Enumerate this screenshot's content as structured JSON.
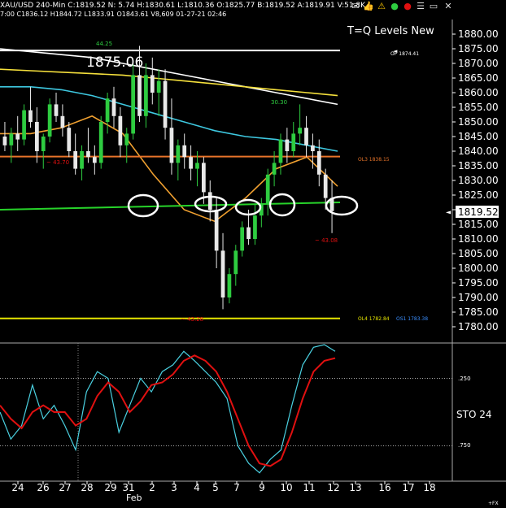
{
  "header": {
    "line1": "XAU/USD  240-Min  C:1819.52  N:  5.74  H:1830.61  L:1810.36  O:1825.77  B:1819.52  A:1819.91  V:51.8K",
    "line2": "7:00  C1836.12  H1844.72  L1833.91  O1843.61  V8,609  01-27-21  02:46"
  },
  "toolbar_icons": [
    "mail-icon",
    "thumbs-up-icon",
    "warning-icon",
    "green-circle-icon",
    "red-circle-icon",
    "list-icon",
    "window-icon",
    "close-icon"
  ],
  "colors": {
    "background": "#000000",
    "up_candle": "#2ecc40",
    "down_candle": "#e8e8e8",
    "ma_white": "#ffffff",
    "ma_yellow": "#f5e03c",
    "ma_cyan": "#3ec8e0",
    "ma_orange": "#f0a030",
    "level_orange": "#e8742a",
    "level_green": "#27d32a",
    "level_yellow": "#e6e600",
    "stoch_red": "#e01010",
    "stoch_cyan": "#4ad0e0"
  },
  "chart_title": "T=Q Levels New",
  "level_labels": {
    "op": "OP  1874.41",
    "ol3": "OL3  1838.15",
    "ol4": "OL4  1782.84",
    "os1": "OS1  1783.38"
  },
  "price_annotations": {
    "high_big": "1875.06",
    "small_44_25": "44.25",
    "mid_43_70": "~ 43.70",
    "right_43_08": "~ 43.08",
    "peak_30_30": "30.30",
    "low_43_28": "~ 43.28"
  },
  "current_price": "1819.52",
  "stoch_label": "STO  24",
  "stoch_levels": {
    "upper": ".250",
    "lower": ".750"
  },
  "fx_label": "+FX",
  "chart_data": [
    {
      "type": "candlestick",
      "title": "T=Q Levels New",
      "symbol": "XAU/USD",
      "timeframe": "240-Min",
      "ylim": [
        1775,
        1885
      ],
      "yticks": [
        1880,
        1875,
        1870,
        1865,
        1860,
        1855,
        1850,
        1845,
        1840,
        1835,
        1830,
        1825,
        1820,
        1815,
        1810,
        1805,
        1800,
        1795,
        1790,
        1785,
        1780
      ],
      "x_ticks": [
        "24",
        "26",
        "27",
        "28",
        "29",
        "31",
        "2",
        "3",
        "4",
        "5",
        "7",
        "9",
        "10",
        "11",
        "12",
        "13",
        "16",
        "17",
        "18"
      ],
      "x_month_label": "Feb",
      "levels": [
        {
          "name": "OP",
          "value": 1874.41
        },
        {
          "name": "OL3",
          "value": 1838.15
        },
        {
          "name": "OL4",
          "value": 1782.84
        },
        {
          "name": "OS1",
          "value": 1783.38
        }
      ],
      "green_level": [
        1820.0,
        1822.5
      ],
      "candles": [
        [
          1845,
          1850,
          1840,
          1842
        ],
        [
          1842,
          1848,
          1836,
          1846
        ],
        [
          1846,
          1852,
          1840,
          1844
        ],
        [
          1844,
          1856,
          1842,
          1854
        ],
        [
          1854,
          1862,
          1848,
          1850
        ],
        [
          1850,
          1855,
          1836,
          1840
        ],
        [
          1840,
          1846,
          1834,
          1845
        ],
        [
          1845,
          1858,
          1843,
          1856
        ],
        [
          1856,
          1860,
          1850,
          1852
        ],
        [
          1852,
          1856,
          1845,
          1848
        ],
        [
          1848,
          1850,
          1838,
          1840
        ],
        [
          1840,
          1846,
          1832,
          1834
        ],
        [
          1834,
          1842,
          1830,
          1840
        ],
        [
          1840,
          1848,
          1836,
          1838
        ],
        [
          1838,
          1842,
          1832,
          1836
        ],
        [
          1836,
          1852,
          1834,
          1850
        ],
        [
          1850,
          1860,
          1846,
          1858
        ],
        [
          1858,
          1862,
          1848,
          1852
        ],
        [
          1852,
          1855,
          1838,
          1842
        ],
        [
          1842,
          1848,
          1836,
          1846
        ],
        [
          1846,
          1870,
          1844,
          1866
        ],
        [
          1866,
          1876,
          1850,
          1852
        ],
        [
          1852,
          1870,
          1848,
          1866
        ],
        [
          1866,
          1872,
          1856,
          1860
        ],
        [
          1860,
          1868,
          1852,
          1864
        ],
        [
          1864,
          1868,
          1844,
          1848
        ],
        [
          1848,
          1858,
          1832,
          1836
        ],
        [
          1836,
          1844,
          1830,
          1842
        ],
        [
          1842,
          1846,
          1834,
          1838
        ],
        [
          1838,
          1842,
          1830,
          1834
        ],
        [
          1834,
          1840,
          1828,
          1836
        ],
        [
          1836,
          1838,
          1822,
          1826
        ],
        [
          1826,
          1830,
          1816,
          1820
        ],
        [
          1820,
          1824,
          1800,
          1806
        ],
        [
          1806,
          1812,
          1786,
          1790
        ],
        [
          1790,
          1800,
          1788,
          1798
        ],
        [
          1798,
          1808,
          1794,
          1806
        ],
        [
          1806,
          1816,
          1804,
          1814
        ],
        [
          1814,
          1820,
          1808,
          1810
        ],
        [
          1810,
          1822,
          1808,
          1818
        ],
        [
          1818,
          1824,
          1814,
          1822
        ],
        [
          1822,
          1834,
          1818,
          1832
        ],
        [
          1832,
          1840,
          1828,
          1836
        ],
        [
          1836,
          1846,
          1832,
          1844
        ],
        [
          1844,
          1848,
          1836,
          1840
        ],
        [
          1840,
          1850,
          1838,
          1846
        ],
        [
          1846,
          1856,
          1842,
          1848
        ],
        [
          1848,
          1852,
          1838,
          1842
        ],
        [
          1842,
          1846,
          1834,
          1840
        ],
        [
          1840,
          1844,
          1828,
          1832
        ],
        [
          1832,
          1834,
          1820,
          1824
        ],
        [
          1824,
          1830,
          1812,
          1819.52
        ]
      ],
      "moving_averages": [
        {
          "color": "white",
          "values": [
            1875,
            1874,
            1873,
            1872,
            1870,
            1868,
            1866,
            1864,
            1862,
            1860,
            1858,
            1856
          ]
        },
        {
          "color": "yellow",
          "values": [
            1868,
            1867.5,
            1867,
            1866.5,
            1866,
            1865,
            1864,
            1863,
            1862,
            1861,
            1860,
            1859
          ]
        },
        {
          "color": "cyan",
          "values": [
            1862,
            1862,
            1861,
            1859,
            1856,
            1853,
            1850,
            1847,
            1845,
            1844,
            1842,
            1840
          ]
        },
        {
          "color": "orange",
          "values": [
            1846,
            1846,
            1848,
            1852,
            1846,
            1832,
            1820,
            1816,
            1824,
            1834,
            1838,
            1828
          ]
        }
      ]
    },
    {
      "type": "line",
      "title": "STO",
      "ylim": [
        0,
        1
      ],
      "levels": [
        0.25,
        0.75
      ],
      "series": [
        {
          "name": "%K",
          "color": "cyan",
          "values": [
            0.5,
            0.7,
            0.6,
            0.3,
            0.55,
            0.45,
            0.6,
            0.78,
            0.35,
            0.2,
            0.25,
            0.65,
            0.45,
            0.25,
            0.35,
            0.2,
            0.15,
            0.05,
            0.12,
            0.2,
            0.28,
            0.4,
            0.75,
            0.88,
            0.95,
            0.85,
            0.78,
            0.45,
            0.15,
            0.02,
            0.0,
            0.05
          ]
        },
        {
          "name": "%D",
          "color": "red",
          "values": [
            0.45,
            0.55,
            0.62,
            0.5,
            0.45,
            0.5,
            0.5,
            0.6,
            0.55,
            0.38,
            0.28,
            0.35,
            0.5,
            0.42,
            0.3,
            0.28,
            0.22,
            0.12,
            0.08,
            0.12,
            0.2,
            0.35,
            0.55,
            0.75,
            0.88,
            0.9,
            0.85,
            0.65,
            0.4,
            0.2,
            0.12,
            0.1
          ]
        }
      ],
      "value_label": "24"
    }
  ]
}
